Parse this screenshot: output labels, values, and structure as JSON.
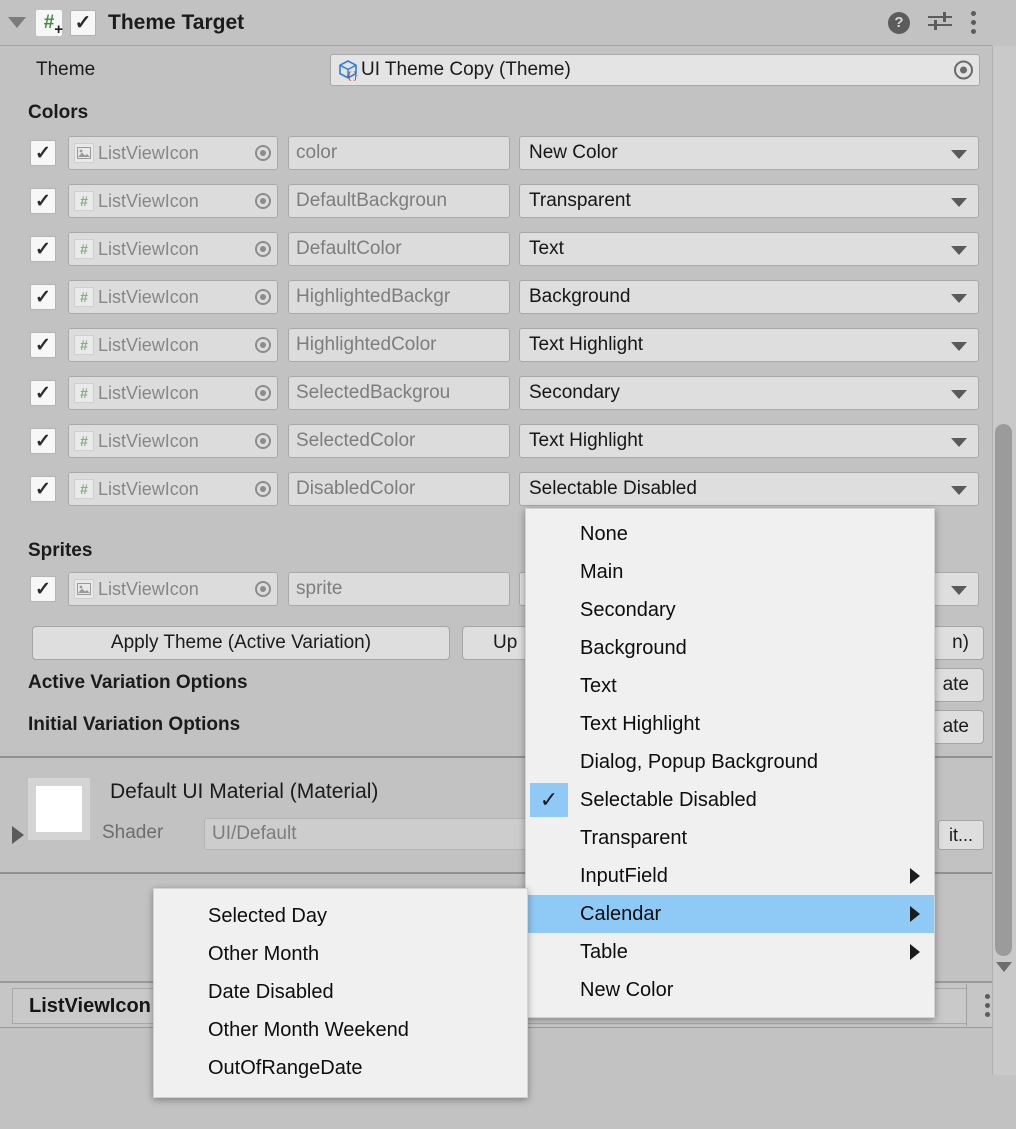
{
  "component_header": {
    "title": "Theme Target",
    "foldout_icon": "triangle-down-icon",
    "script_icon": "csharp-script-icon",
    "enabled_checkbox": "✓",
    "help_icon": "?",
    "settings_icon": "preset-settings-icon",
    "kebab_icon": "more-options-icon"
  },
  "theme_field": {
    "label": "Theme",
    "value": "UI Theme Copy (Theme)",
    "object_icon": "scriptable-object-icon",
    "picker_icon": "object-picker-icon"
  },
  "sections": {
    "colors_label": "Colors",
    "sprites_label": "Sprites",
    "active_variation_label": "Active Variation Options",
    "initial_variation_label": "Initial Variation Options"
  },
  "color_rows": [
    {
      "enabled": "✓",
      "target": "ListViewIcon",
      "icon": "image-component-icon",
      "property": "color",
      "value": "New Color"
    },
    {
      "enabled": "✓",
      "target": "ListViewIcon",
      "icon": "csharp-script-icon",
      "property": "DefaultBackgroun",
      "value": "Transparent"
    },
    {
      "enabled": "✓",
      "target": "ListViewIcon",
      "icon": "csharp-script-icon",
      "property": "DefaultColor",
      "value": "Text"
    },
    {
      "enabled": "✓",
      "target": "ListViewIcon",
      "icon": "csharp-script-icon",
      "property": "HighlightedBackgr",
      "value": "Background"
    },
    {
      "enabled": "✓",
      "target": "ListViewIcon",
      "icon": "csharp-script-icon",
      "property": "HighlightedColor",
      "value": "Text Highlight"
    },
    {
      "enabled": "✓",
      "target": "ListViewIcon",
      "icon": "csharp-script-icon",
      "property": "SelectedBackgrou",
      "value": "Secondary"
    },
    {
      "enabled": "✓",
      "target": "ListViewIcon",
      "icon": "csharp-script-icon",
      "property": "SelectedColor",
      "value": "Text Highlight"
    },
    {
      "enabled": "✓",
      "target": "ListViewIcon",
      "icon": "csharp-script-icon",
      "property": "DisabledColor",
      "value": "Selectable Disabled"
    }
  ],
  "sprite_rows": [
    {
      "enabled": "✓",
      "target": "ListViewIcon",
      "icon": "image-component-icon",
      "property": "sprite",
      "value": ""
    }
  ],
  "buttons": {
    "apply_theme": "Apply Theme (Active Variation)",
    "update_partial": "Up",
    "right_clipped_1": "n)",
    "right_clipped_2": "ate",
    "right_clipped_3": "ate"
  },
  "material": {
    "title": "Default UI Material (Material)",
    "shader_label": "Shader",
    "shader_value": "UI/Default",
    "edit_button": "it...",
    "foldout_icon": "triangle-right-icon"
  },
  "bottom": {
    "asset_name": "ListViewIcon",
    "kebab_icon": "more-options-icon"
  },
  "scrollbar": {
    "down_arrow_icon": "triangle-down-icon"
  },
  "popup_main": {
    "items": [
      {
        "label": "None",
        "checked": false,
        "submenu": false,
        "highlighted": false
      },
      {
        "label": "Main",
        "checked": false,
        "submenu": false,
        "highlighted": false
      },
      {
        "label": "Secondary",
        "checked": false,
        "submenu": false,
        "highlighted": false
      },
      {
        "label": "Background",
        "checked": false,
        "submenu": false,
        "highlighted": false
      },
      {
        "label": "Text",
        "checked": false,
        "submenu": false,
        "highlighted": false
      },
      {
        "label": "Text Highlight",
        "checked": false,
        "submenu": false,
        "highlighted": false
      },
      {
        "label": "Dialog, Popup Background",
        "checked": false,
        "submenu": false,
        "highlighted": false
      },
      {
        "label": "Selectable Disabled",
        "checked": true,
        "submenu": false,
        "highlighted": false
      },
      {
        "label": "Transparent",
        "checked": false,
        "submenu": false,
        "highlighted": false
      },
      {
        "label": "InputField",
        "checked": false,
        "submenu": true,
        "highlighted": false
      },
      {
        "label": "Calendar",
        "checked": false,
        "submenu": true,
        "highlighted": true
      },
      {
        "label": "Table",
        "checked": false,
        "submenu": true,
        "highlighted": false
      },
      {
        "label": "New Color",
        "checked": false,
        "submenu": false,
        "highlighted": false
      }
    ],
    "check_mark": "✓"
  },
  "popup_sub": {
    "items": [
      {
        "label": "Selected Day"
      },
      {
        "label": "Other Month"
      },
      {
        "label": "Date Disabled"
      },
      {
        "label": "Other Month Weekend"
      },
      {
        "label": "OutOfRangeDate"
      }
    ]
  },
  "colors": {
    "panel_bg": "#c2c2c2",
    "menu_bg": "#f0f0f0",
    "highlight_blue": "#8fc9f5",
    "field_bg": "#dcdcdc",
    "text": "#1b1b1b",
    "muted_text": "#7d7d7d"
  }
}
